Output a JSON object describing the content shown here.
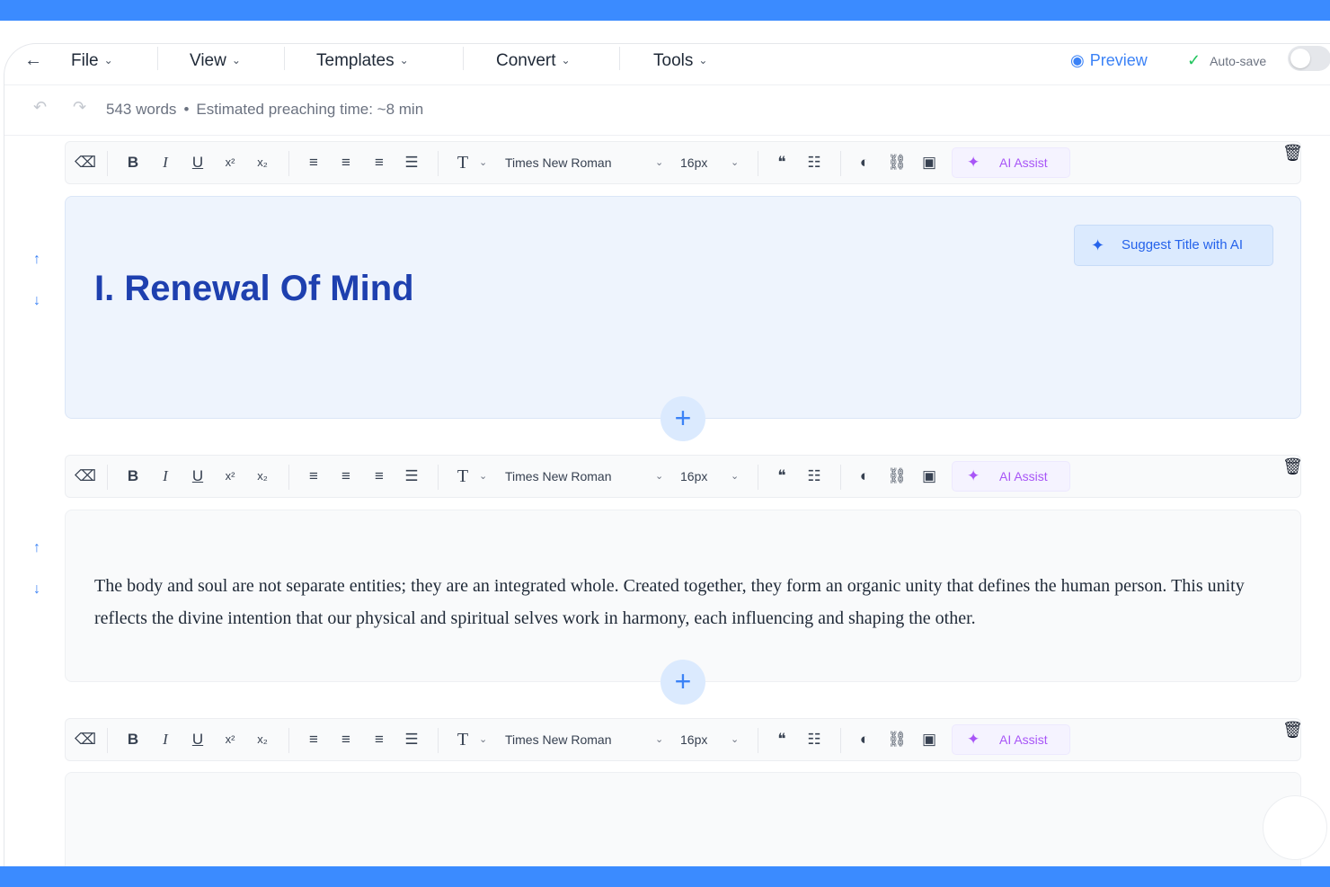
{
  "colors": {
    "accent": "#3b8bff",
    "heading": "#1e40af",
    "ai": "#a855f7",
    "success": "#22c55e"
  },
  "menubar": {
    "items": [
      {
        "label": "File"
      },
      {
        "label": "View"
      },
      {
        "label": "Templates"
      },
      {
        "label": "Convert"
      },
      {
        "label": "Tools"
      }
    ],
    "preview_label": "Preview",
    "autosave_label": "Auto-save",
    "autosave_on": false
  },
  "info": {
    "words": "543 words",
    "separator": "•",
    "preaching_time": "Estimated preaching time: ~8 min"
  },
  "toolbar": {
    "font_family": "Times New Roman",
    "font_size": "16px",
    "ai_label": "AI Assist",
    "icons": [
      "eraser-icon",
      "bold-icon",
      "italic-icon",
      "underline-icon",
      "superscript-icon",
      "subscript-icon",
      "align-left-icon",
      "align-center-icon",
      "align-right-icon",
      "align-justify-icon",
      "text-type-icon",
      "quote-icon",
      "list-icon",
      "palette-icon",
      "link-icon",
      "image-icon",
      "sparkle-icon",
      "trash-icon"
    ]
  },
  "blocks": [
    {
      "type": "title",
      "text": "I. Renewal Of Mind",
      "suggest_label": "Suggest Title with AI"
    },
    {
      "type": "paragraph",
      "text": "The body and soul are not separate entities; they are an integrated whole. Created together, they form an organic unity that defines the human person. This unity reflects the divine intention that our physical and spiritual selves work in harmony, each influencing and shaping the other."
    },
    {
      "type": "paragraph",
      "text": ""
    }
  ]
}
